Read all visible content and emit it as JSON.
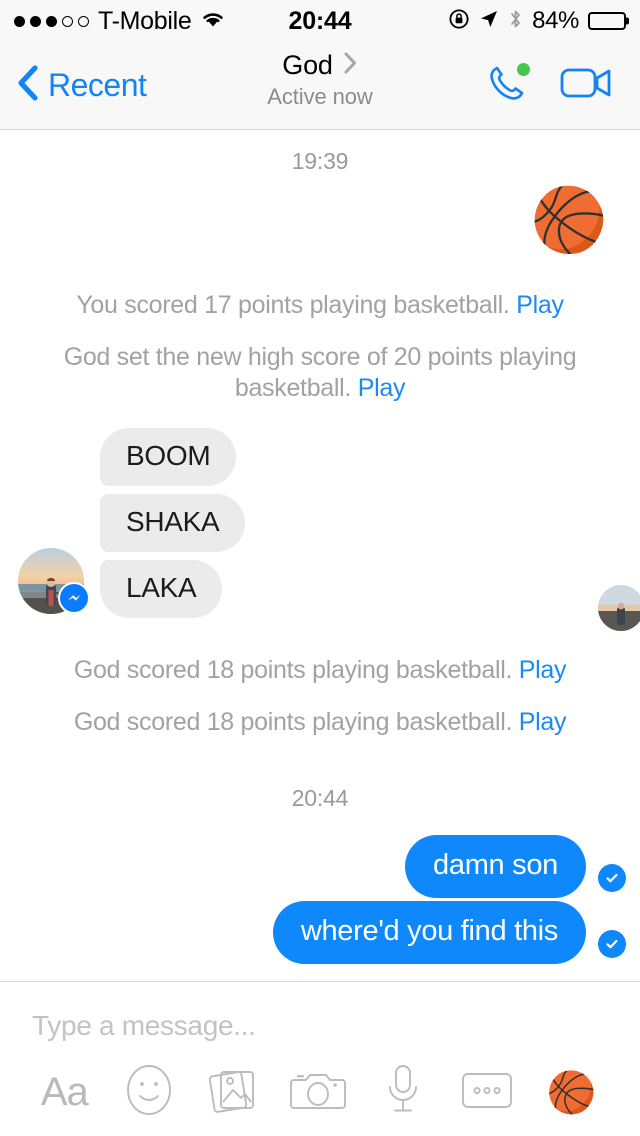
{
  "status_bar": {
    "signal_dots_filled": 3,
    "signal_dots_total": 5,
    "carrier": "T-Mobile",
    "wifi_icon": "wifi-icon",
    "time": "20:44",
    "rotation_lock_icon": "rotation-lock-icon",
    "location_icon": "location-arrow-icon",
    "bluetooth_icon": "bluetooth-icon",
    "battery_percent": "84%",
    "battery_level": 84
  },
  "nav": {
    "back_label": "Recent",
    "back_icon": "chevron-left-icon",
    "title": "God",
    "title_chevron_icon": "chevron-right-icon",
    "subtitle": "Active now",
    "call_icon": "phone-call-icon",
    "video_icon": "video-camera-icon",
    "active_status_color": "#44c94a",
    "accent_color": "#1384f5"
  },
  "thread": {
    "timestamp_top": "19:39",
    "timestamp_mid": "20:44",
    "basketball_emoji": "🏀",
    "system_messages": [
      {
        "text": "You scored 17 points playing basketball. ",
        "link": "Play"
      },
      {
        "text": "God set the new high score of 20 points playing basketball. ",
        "link": "Play"
      },
      {
        "text": "God scored 18 points playing basketball. ",
        "link": "Play"
      },
      {
        "text": "God scored 18 points playing basketball. ",
        "link": "Play"
      }
    ],
    "incoming_bubbles": [
      "BOOM",
      "SHAKA",
      "LAKA"
    ],
    "outgoing_bubbles": [
      {
        "text": "damn son",
        "receipt_icon": "check-circle-filled-icon"
      },
      {
        "text": "where'd you find this",
        "receipt_icon": "check-circle-filled-icon"
      }
    ],
    "avatar": {
      "name": "sender-avatar",
      "description": "person standing on beach at sunset",
      "badge_icon": "messenger-badge-icon"
    },
    "bubble_in_color": "#ebebeb",
    "bubble_out_color": "#0f88fb",
    "link_color": "#1b8af5",
    "system_text_color": "#a2a2a2"
  },
  "composer": {
    "placeholder": "Type a message...",
    "tools": [
      {
        "name": "text-format-button",
        "label": "Aa",
        "icon": "aa-icon"
      },
      {
        "name": "sticker-button",
        "label": "",
        "icon": "smiley-face-icon"
      },
      {
        "name": "photo-library-button",
        "label": "",
        "icon": "photos-icon"
      },
      {
        "name": "camera-button",
        "label": "",
        "icon": "camera-icon"
      },
      {
        "name": "voice-message-button",
        "label": "",
        "icon": "microphone-icon"
      },
      {
        "name": "more-options-button",
        "label": "",
        "icon": "more-dots-icon"
      },
      {
        "name": "basketball-game-button",
        "label": "🏀",
        "icon": "basketball-icon"
      }
    ]
  }
}
